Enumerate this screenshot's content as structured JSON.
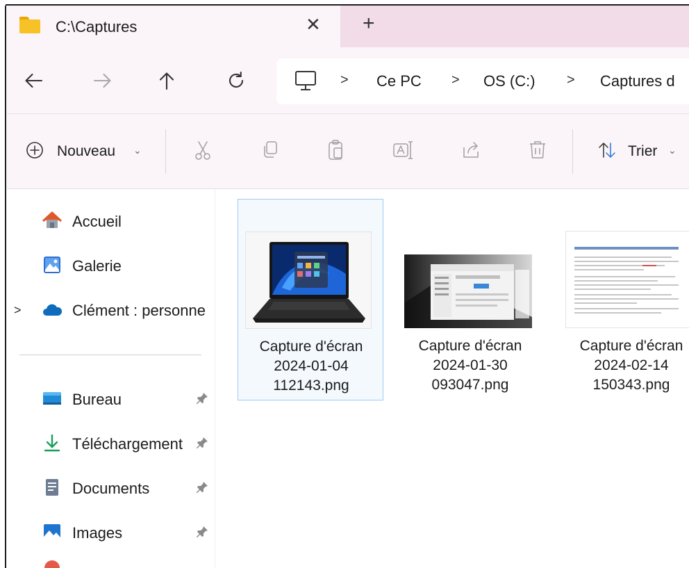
{
  "tab": {
    "title": "C:\\Captures",
    "close_label": "✕",
    "new_tab_label": "+"
  },
  "address": {
    "crumbs": [
      "Ce PC",
      "OS (C:)",
      "Captures d"
    ],
    "separator": ">"
  },
  "commandbar": {
    "new_label": "Nouveau",
    "sort_label": "Trier",
    "chevron": "⌄"
  },
  "nav": {
    "items": [
      {
        "label": "Accueil"
      },
      {
        "label": "Galerie"
      },
      {
        "label": "Clément : personne"
      },
      {
        "label": "Bureau"
      },
      {
        "label": "Téléchargement"
      },
      {
        "label": "Documents"
      },
      {
        "label": "Images"
      }
    ],
    "expand_chevron": ">"
  },
  "files": [
    {
      "line1": "Capture d'écran",
      "line2": "2024-01-04",
      "line3": "112143.png",
      "selected": true
    },
    {
      "line1": "Capture d'écran",
      "line2": "2024-01-30",
      "line3": "093047.png",
      "selected": false
    },
    {
      "line1": "Capture d'écran",
      "line2": "2024-02-14",
      "line3": "150343.png",
      "selected": false
    }
  ],
  "colors": {
    "tab_strip_bg": "#f1dce8",
    "chrome_bg": "#fbf4f8",
    "selection_border": "#9ecbf3",
    "folder_yellow": "#f6c227"
  }
}
